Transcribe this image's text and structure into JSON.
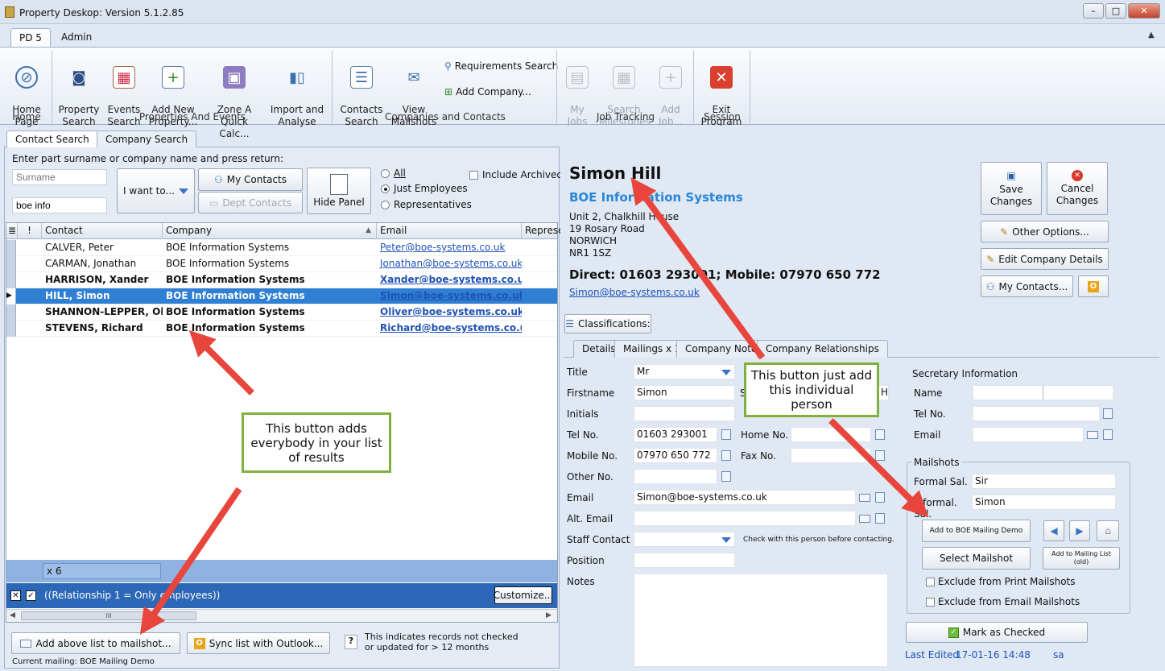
{
  "window": {
    "title": "Property Deskop: Version 5.1.2.85",
    "min_label": "–",
    "max_label": "□",
    "close_label": "✕"
  },
  "ribbon_tabs": [
    "PD 5",
    "Admin"
  ],
  "ribbon": {
    "home": {
      "label": "Home\nPage",
      "group": "Home"
    },
    "property_search": "Property\nSearch",
    "events_search": "Events\nSearch",
    "add_property": "Add New\nProperty...",
    "zone_a": "Zone A\nQuick Calc...",
    "import_analyse": "Import and\nAnalyse",
    "group_properties": "Properties And Events",
    "contacts_search": "Contacts\nSearch",
    "view_mailshots": "View\nMailshots",
    "requirements_search": "Requirements Search",
    "add_company": "Add Company...",
    "group_companies": "Companies and Contacts",
    "my_jobs": "My\nJobs",
    "search_milestones": "Search\nMilestones",
    "add_job": "Add\nJob...",
    "group_jobs": "Job Tracking",
    "exit_program": "Exit\nProgram",
    "group_session": "Session"
  },
  "search_tabs": [
    "Contact Search",
    "Company Search"
  ],
  "search": {
    "instruction": "Enter part surname or company name and press return:",
    "surname_placeholder": "Surname",
    "company_value": "boe info",
    "i_want_to": "I want to...",
    "my_contacts": "My Contacts",
    "dept_contacts": "Dept Contacts",
    "hide_panel": "Hide Panel",
    "radio_all": "All",
    "radio_just_employees": "Just Employees",
    "radio_representatives": "Representatives",
    "include_archived": "Include Archived"
  },
  "grid": {
    "headers": [
      "!",
      "Contact",
      "Company",
      "Email",
      "Represe"
    ],
    "rows": [
      {
        "contact": "CALVER, Peter",
        "company": "BOE Information Systems",
        "email": "Peter@boe-systems.co.uk",
        "bold": false,
        "selected": false
      },
      {
        "contact": "CARMAN, Jonathan",
        "company": "BOE Information Systems",
        "email": "Jonathan@boe-systems.co.uk",
        "bold": false,
        "selected": false
      },
      {
        "contact": "HARRISON, Xander",
        "company": "BOE Information Systems",
        "email": "Xander@boe-systems.co.uk",
        "bold": true,
        "selected": false
      },
      {
        "contact": "HILL, Simon",
        "company": "BOE Information Systems",
        "email": "Simon@boe-systems.co.uk",
        "bold": true,
        "selected": true
      },
      {
        "contact": "SHANNON-LEPPER, Oliver",
        "company": "BOE Information Systems",
        "email": "Oliver@boe-systems.co.uk",
        "bold": true,
        "selected": false
      },
      {
        "contact": "STEVENS, Richard",
        "company": "BOE Information Systems",
        "email": "Richard@boe-systems.co.uk",
        "bold": true,
        "selected": false
      }
    ],
    "count": "x 6",
    "filter": "((Relationship 1 = Only employees))",
    "customize": "Customize...",
    "scroll_grip": "III"
  },
  "bottom": {
    "add_to_mailshot": "Add above list to mailshot...",
    "sync_outlook": "Sync list with Outlook...",
    "help_q": "?",
    "note": "This indicates records not checked\nor updated for > 12 months",
    "current_mailing": "Current mailing:  BOE Mailing Demo"
  },
  "contact": {
    "name": "Simon Hill",
    "company": "BOE Information Systems",
    "address": [
      "Unit 2, Chalkhill House",
      "19 Rosary Road",
      "NORWICH",
      "NR1 1SZ"
    ],
    "phones": "Direct: 01603 293001; Mobile: 07970 650 772",
    "email": "Simon@boe-systems.co.uk",
    "classifications": "Classifications:"
  },
  "actions": {
    "save": "Save\nChanges",
    "cancel": "Cancel\nChanges",
    "other_options": "Other Options...",
    "edit_company": "Edit Company Details",
    "my_contacts": "My Contacts..."
  },
  "detail_tabs": [
    "Details",
    "Mailings x 1",
    "Company Notes",
    "Company Relationships"
  ],
  "details": {
    "title_label": "Title",
    "title_value": "Mr",
    "firstname_label": "Firstname",
    "firstname_value": "Simon",
    "surname_label": "Surname",
    "surname_value": "Hill",
    "initials_label": "Initials",
    "tel_label": "Tel No.",
    "tel_value": "01603 293001",
    "home_label": "Home No.",
    "mobile_label": "Mobile No.",
    "mobile_value": "07970 650 772",
    "fax_label": "Fax No.",
    "other_label": "Other No.",
    "email_label": "Email",
    "email_value": "Simon@boe-systems.co.uk",
    "alt_email_label": "Alt. Email",
    "staff_label": "Staff Contact",
    "staff_note": "Check with this person before contacting.",
    "position_label": "Position",
    "notes_label": "Notes"
  },
  "secretary": {
    "heading": "Secretary Information",
    "name_label": "Name",
    "tel_label": "Tel No.",
    "email_label": "Email"
  },
  "mailshots": {
    "heading": "Mailshots",
    "formal_label": "Formal Sal.",
    "formal_value": "Sir",
    "informal_label": "Informal. Sal.",
    "informal_value": "Simon",
    "add_to_boe": "Add to BOE Mailing Demo",
    "select_mailshot": "Select Mailshot",
    "add_to_list_old": "Add to Mailing List\n(old)",
    "exclude_print": "Exclude from Print Mailshots",
    "exclude_email": "Exclude from Email Mailshots"
  },
  "mark_checked": "Mark as Checked",
  "last_edited": {
    "label": "Last Edited",
    "date": "17-01-16 14:48",
    "user": "sa"
  },
  "callouts": {
    "everybody": "This button adds everybody in your list of results",
    "individual": "This button just add this individual person"
  },
  "colors": {
    "accent_blue": "#2f7fd3",
    "callout_border": "#7fb13c",
    "arrow_red": "#e8453c",
    "company_blue": "#2a86d6"
  }
}
